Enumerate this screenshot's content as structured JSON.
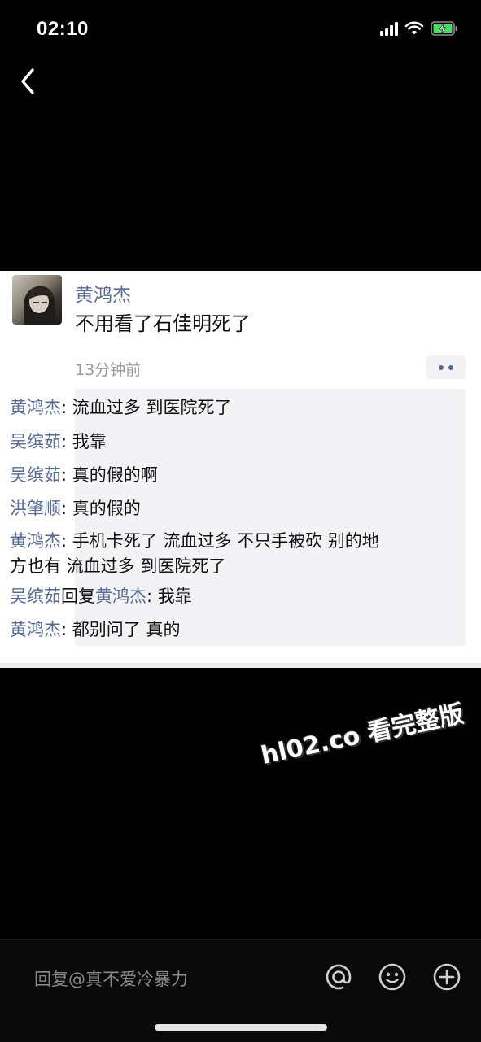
{
  "status_bar": {
    "time": "02:10"
  },
  "post": {
    "author": "黄鸿杰",
    "text": "不用看了石佳明死了",
    "time": "13分钟前"
  },
  "comments": [
    {
      "name": "黄鸿杰",
      "sep": ": ",
      "text": "流血过多 到医院死了"
    },
    {
      "name": "吴缤茹",
      "sep": ": ",
      "text": "我靠"
    },
    {
      "name": "吴缤茹",
      "sep": ": ",
      "text": "真的假的啊"
    },
    {
      "name": "洪肇顺",
      "sep": ": ",
      "text": "真的假的"
    },
    {
      "name": "黄鸿杰",
      "sep": ": ",
      "text": "手机卡死了 流血过多 不只手被砍 别的地方也有 流血过多 到医院死了"
    },
    {
      "name": "吴缤茹",
      "reply_word": "回复",
      "reply_to": "黄鸿杰",
      "sep": ": ",
      "text": "我靠"
    },
    {
      "name": "黄鸿杰",
      "sep": ": ",
      "text": "都别问了 真的"
    }
  ],
  "watermark": "hl02.co 看完整版",
  "reply_bar": {
    "placeholder": "回复@真不爱冷暴力"
  },
  "icons": {
    "back": "chevron-left-icon",
    "at": "at-icon",
    "emoji": "emoji-icon",
    "add": "plus-circle-icon",
    "signal": "signal-icon",
    "wifi": "wifi-icon",
    "battery": "battery-charging-icon",
    "more": "more-dots-icon"
  },
  "colors": {
    "name_link": "#576b95",
    "battery_green": "#4cd964",
    "background": "#000000",
    "card": "#ffffff",
    "comment_box": "#f3f3f5"
  }
}
